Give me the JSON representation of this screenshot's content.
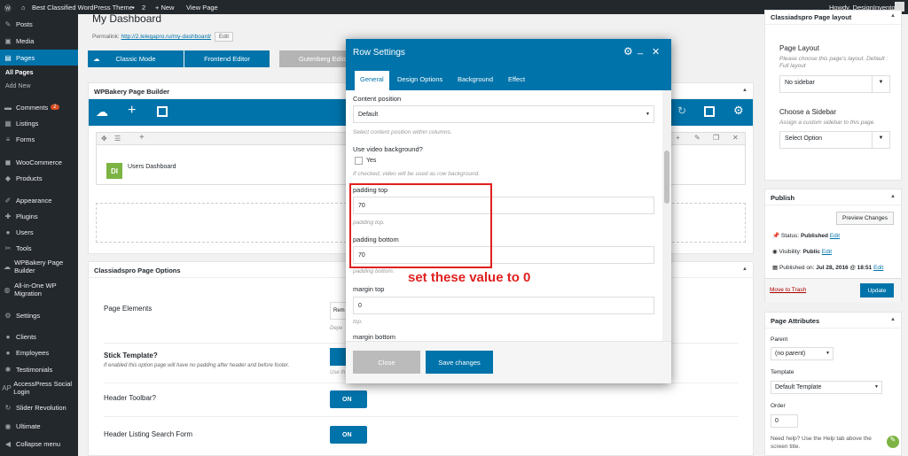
{
  "adminbar": {
    "site": "Best Classified WordPress Theme",
    "comments": "2",
    "new": "+ New",
    "view": "View Page",
    "howdy": "Howdy, DesignInvento"
  },
  "sidebar": {
    "items": [
      {
        "label": "Posts",
        "icon": "pin-icon"
      },
      {
        "label": "Media",
        "icon": "media-icon"
      },
      {
        "label": "Pages",
        "icon": "pages-icon"
      },
      {
        "label": "Comments",
        "icon": "comment-icon",
        "badge": "2"
      },
      {
        "label": "Listings",
        "icon": "listing-icon"
      },
      {
        "label": "Forms",
        "icon": "forms-icon"
      },
      {
        "label": "WooCommerce",
        "icon": "woo-icon"
      },
      {
        "label": "Products",
        "icon": "products-icon"
      },
      {
        "label": "Appearance",
        "icon": "brush-icon"
      },
      {
        "label": "Plugins",
        "icon": "plugin-icon"
      },
      {
        "label": "Users",
        "icon": "users-icon"
      },
      {
        "label": "Tools",
        "icon": "tools-icon"
      },
      {
        "label": "WPBakery Page Builder",
        "icon": "wpbakery-icon"
      },
      {
        "label": "All-in-One WP Migration",
        "icon": "migration-icon"
      },
      {
        "label": "Settings",
        "icon": "settings-icon"
      },
      {
        "label": "Clients",
        "icon": "clients-icon"
      },
      {
        "label": "Employees",
        "icon": "employees-icon"
      },
      {
        "label": "Testimonials",
        "icon": "testimonials-icon"
      },
      {
        "label": "AccessPress Social Login",
        "icon": "ap-icon"
      },
      {
        "label": "Slider Revolution",
        "icon": "slider-icon"
      },
      {
        "label": "Ultimate",
        "icon": "ultimate-icon"
      },
      {
        "label": "Collapse menu",
        "icon": "collapse-icon"
      }
    ],
    "sub_all": "All Pages",
    "sub_add": "Add New"
  },
  "main": {
    "title": "My Dashboard",
    "permalink_label": "Permalink:",
    "permalink_url": "http://2.telegapro.ru/my-dashboard/",
    "edit": "Edit",
    "classic": "Classic Mode",
    "frontend": "Frontend Editor",
    "gutenberg": "Gutenberg Edito",
    "builder_title": "WPBakery Page Builder",
    "element_badge": "DI",
    "element_name": "Users Dashboard",
    "options_title": "Classiadspro Page Options",
    "opt1": "Page Elements",
    "opt1_val": "Rem",
    "opt1_help": "Depe",
    "opt2": "Stick Template?",
    "opt2_help": "If enabled this option page will have no padding after header and before footer.",
    "opt2_help2": "Use th",
    "opt3": "Header Toolbar?",
    "opt3_val": "ON",
    "opt4": "Header Listing Search Form",
    "opt4_val": "ON"
  },
  "layout_box": {
    "title": "Classiadspro Page layout",
    "page_layout": "Page Layout",
    "pl_help": "Please choose this page's layout. Default : Full layout",
    "pl_val": "No sidebar",
    "choose": "Choose a Sidebar",
    "cs_help": "Assign a custom sidebar to this page.",
    "cs_val": "Select Option"
  },
  "publish": {
    "title": "Publish",
    "preview": "Preview Changes",
    "status_label": "Status:",
    "status_val": "Published",
    "visibility_label": "Visibility:",
    "visibility_val": "Public",
    "published_label": "Published on:",
    "published_val": "Jul 28, 2016 @ 18:51",
    "edit": "Edit",
    "trash": "Move to Trash",
    "update": "Update"
  },
  "attributes": {
    "title": "Page Attributes",
    "parent": "Parent",
    "parent_val": "(no parent)",
    "template": "Template",
    "template_val": "Default Template",
    "order": "Order",
    "order_val": "0",
    "help": "Need help? Use the Help tab above the screen title."
  },
  "modal": {
    "title": "Row Settings",
    "tabs": [
      "General",
      "Design Options",
      "Background",
      "Effect"
    ],
    "content_position": "Content position",
    "cp_val": "Default",
    "cp_help": "Select content position within columns.",
    "video_label": "Use video background?",
    "video_yes": "Yes",
    "video_help": "If checked, video will be used as row background.",
    "pt_label": "padding top",
    "pt_val": "70",
    "pt_help": "padding top.",
    "pb_label": "padding bottom",
    "pb_val": "70",
    "pb_help": "padding bottom.",
    "mt_label": "margin top",
    "mt_val": "0",
    "mt_help": "top.",
    "mb_label": "margin bottom",
    "close": "Close",
    "save": "Save changes"
  },
  "annotation": {
    "text": "set these value to 0",
    "color": "#e02020"
  }
}
